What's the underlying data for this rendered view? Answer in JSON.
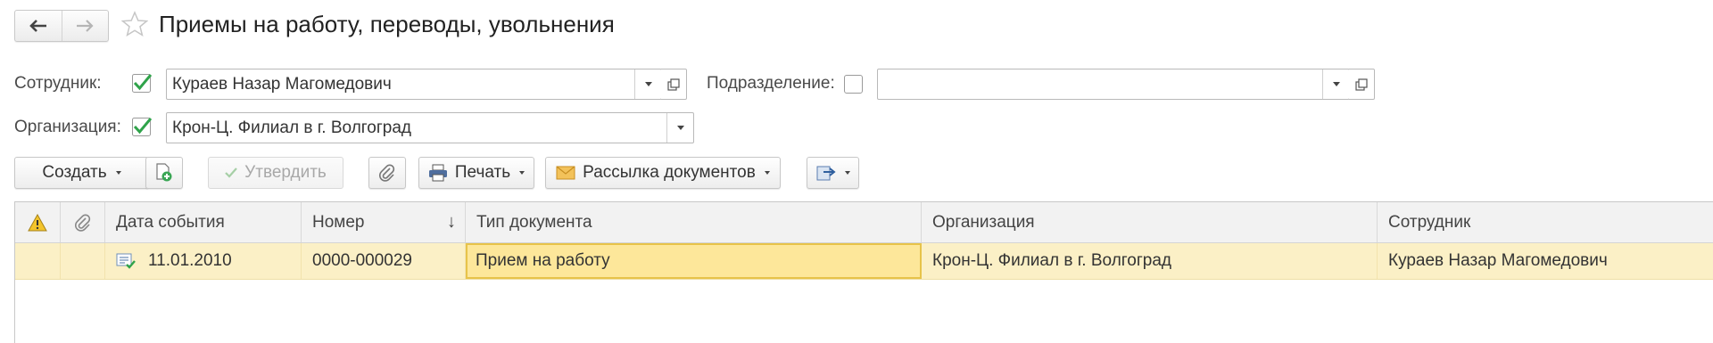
{
  "header": {
    "title": "Приемы на работу, переводы, увольнения"
  },
  "filters": {
    "employee": {
      "label": "Сотрудник:",
      "checked": true,
      "value": "Кураев Назар Магомедович"
    },
    "department": {
      "label": "Подразделение:",
      "checked": false,
      "value": ""
    },
    "organization": {
      "label": "Организация:",
      "checked": true,
      "value": "Крон-Ц. Филиал в г. Волгоград"
    }
  },
  "toolbar": {
    "create_label": "Создать",
    "approve_label": "Утвердить",
    "print_label": "Печать",
    "mailing_label": "Рассылка документов"
  },
  "table": {
    "columns": {
      "event_date": "Дата события",
      "number": "Номер",
      "doc_type": "Тип документа",
      "organization": "Организация",
      "employee": "Сотрудник"
    },
    "sort_indicator": "↓",
    "rows": [
      {
        "event_date": "11.01.2010",
        "number": "0000-000029",
        "doc_type": "Прием на работу",
        "organization": "Крон-Ц. Филиал в г. Волгоград",
        "employee": "Кураев Назар Магомедович"
      }
    ]
  },
  "colors": {
    "accent_check": "#2fa34a",
    "selected_row": "#fbf0c6",
    "selected_cell": "#fde79a"
  },
  "icons": [
    "back-arrow-icon",
    "forward-arrow-icon",
    "star-icon",
    "checkmark-icon",
    "open-icon",
    "add-document-icon",
    "paperclip-icon",
    "printer-icon",
    "envelope-icon",
    "export-icon",
    "warning-icon",
    "posted-document-icon"
  ]
}
